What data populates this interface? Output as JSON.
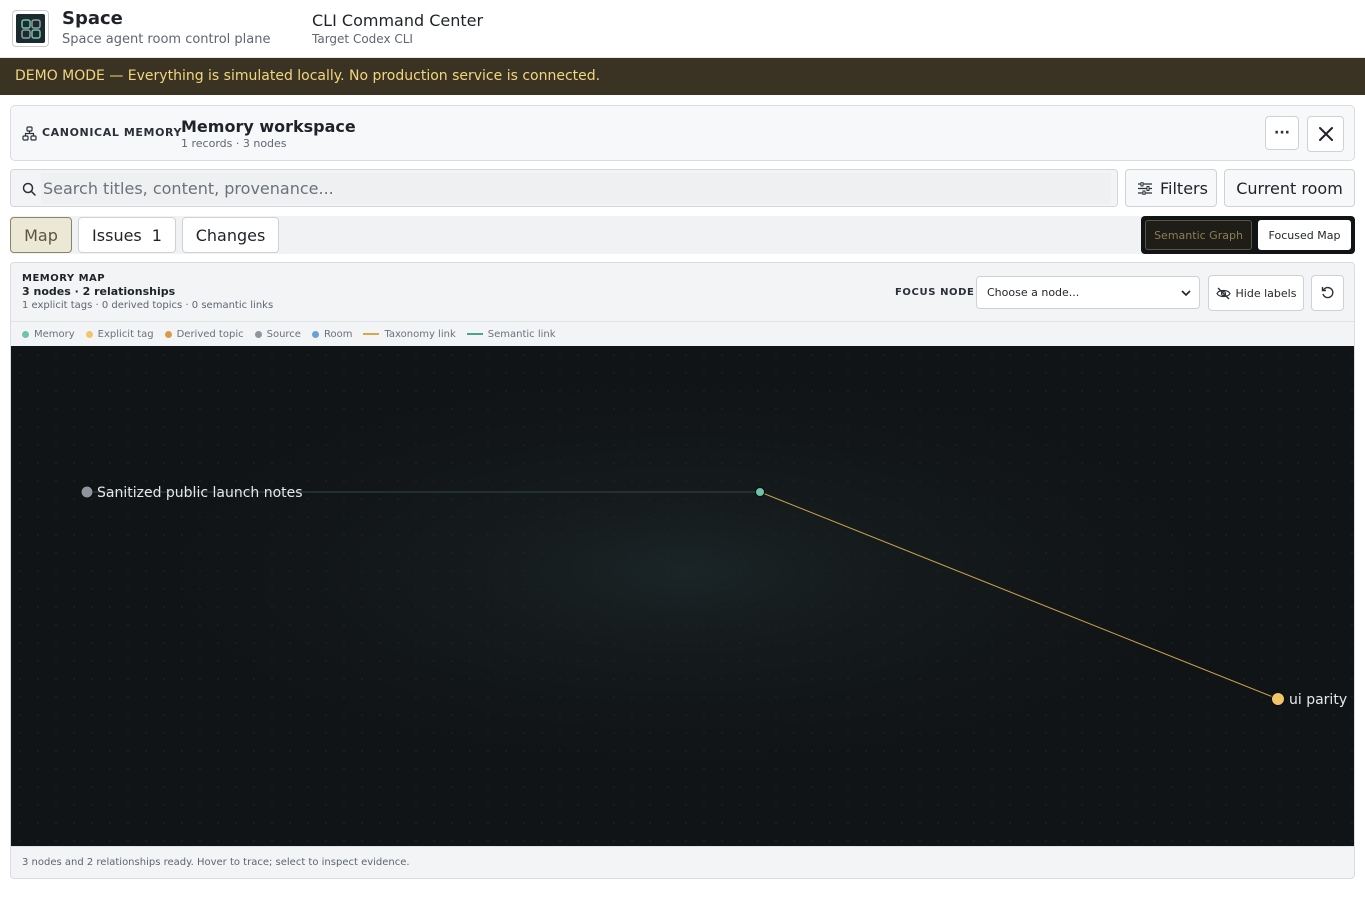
{
  "app": {
    "name": "Space",
    "subtitle": "Space agent room control plane",
    "center_title": "CLI Command Center",
    "center_subtitle": "Target Codex CLI"
  },
  "banner": {
    "text": "DEMO MODE — Everything is simulated locally. No production service is connected."
  },
  "workspace": {
    "section_label": "CANONICAL MEMORY",
    "title": "Memory workspace",
    "meta": "1 records · 3 nodes",
    "more_label": "···"
  },
  "search": {
    "placeholder": "Search titles, content, provenance...",
    "value": ""
  },
  "toolbar": {
    "filters_label": "Filters",
    "scope_label": "Current room"
  },
  "tabs": [
    {
      "label": "Map",
      "active": true
    },
    {
      "label": "Issues",
      "count": "1"
    },
    {
      "label": "Changes"
    }
  ],
  "view_modes": [
    {
      "label": "Semantic Graph",
      "active": false
    },
    {
      "label": "Focused Map",
      "active": true
    }
  ],
  "memory_map": {
    "label": "MEMORY MAP",
    "counts": "3 nodes · 2 relationships",
    "detail": "1 explicit tags · 0 derived topics · 0 semantic links",
    "focus_label": "FOCUS NODE",
    "focus_value": "Choose a node...",
    "hide_labels": "Hide labels"
  },
  "legend": [
    {
      "label": "Memory",
      "kind": "dot",
      "color": "#6fc3a8"
    },
    {
      "label": "Explicit tag",
      "kind": "dot",
      "color": "#f0c66a"
    },
    {
      "label": "Derived topic",
      "kind": "dot",
      "color": "#d89b4b"
    },
    {
      "label": "Source",
      "kind": "dot",
      "color": "#8f959c"
    },
    {
      "label": "Room",
      "kind": "dot",
      "color": "#6d9fd6"
    },
    {
      "label": "Taxonomy link",
      "kind": "line",
      "color": "#d9a54a"
    },
    {
      "label": "Semantic link",
      "kind": "line",
      "color": "#4aa38c"
    }
  ],
  "graph": {
    "nodes": [
      {
        "id": "source",
        "label": "Sanitized public launch notes",
        "type": "Source",
        "color": "#8f959c"
      },
      {
        "id": "memory",
        "label": "",
        "type": "Memory",
        "color": "#6fc3a8"
      },
      {
        "id": "tag",
        "label": "ui parity",
        "type": "Explicit tag",
        "color": "#f0c66a"
      }
    ],
    "edges": [
      {
        "from": "source",
        "to": "memory",
        "color": "#2f4a44"
      },
      {
        "from": "memory",
        "to": "tag",
        "color": "#c9a04a"
      }
    ]
  },
  "status": {
    "text": "3 nodes and 2 relationships ready. Hover to trace; select to inspect evidence."
  }
}
